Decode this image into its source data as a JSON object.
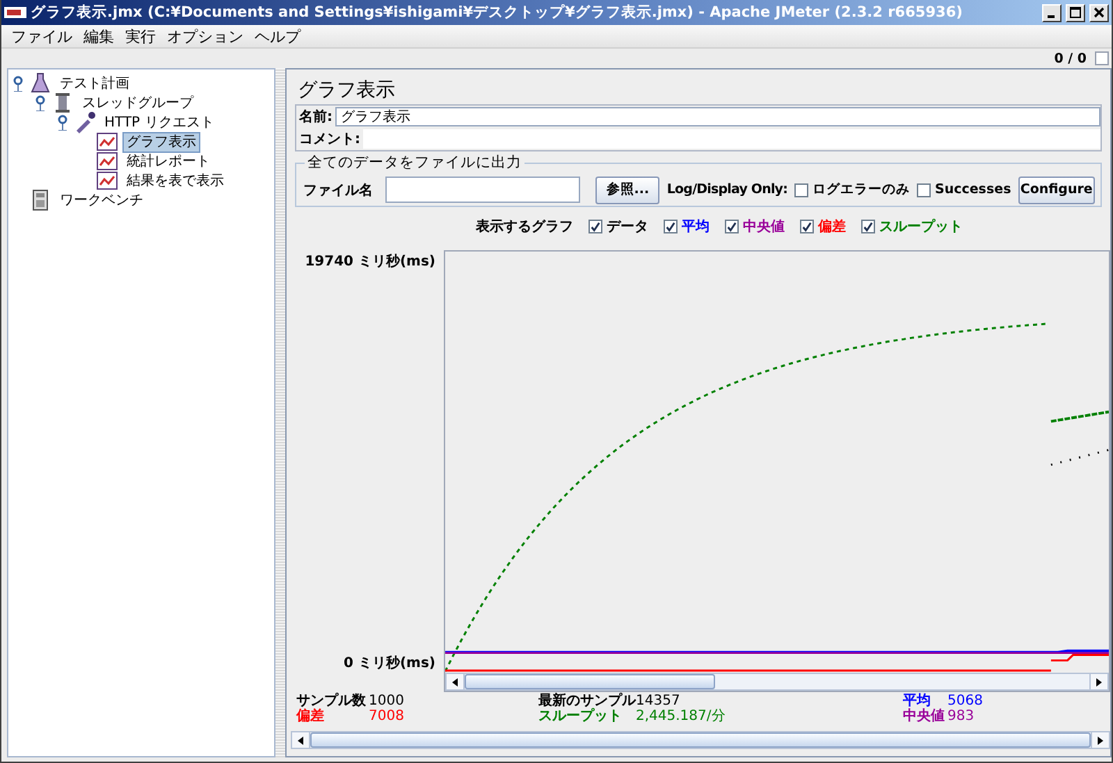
{
  "window": {
    "title": "グラフ表示.jmx (C:¥Documents and Settings¥ishigami¥デスクトップ¥グラフ表示.jmx) - Apache JMeter (2.3.2 r665936)"
  },
  "menu": [
    "ファイル",
    "編集",
    "実行",
    "オプション",
    "ヘルプ"
  ],
  "toolbar": {
    "counter": "0 / 0"
  },
  "tree": [
    {
      "label": "テスト計画",
      "kind": "plan",
      "selected": false,
      "children": [
        {
          "label": "スレッドグループ",
          "kind": "thread-group",
          "selected": false,
          "children": [
            {
              "label": "HTTP リクエスト",
              "kind": "sampler",
              "selected": false,
              "children": [
                {
                  "label": "グラフ表示",
                  "kind": "listener",
                  "selected": true
                },
                {
                  "label": "統計レポート",
                  "kind": "listener",
                  "selected": false
                },
                {
                  "label": "結果を表で表示",
                  "kind": "listener",
                  "selected": false
                }
              ]
            }
          ]
        }
      ]
    },
    {
      "label": "ワークベンチ",
      "kind": "workbench",
      "selected": false
    }
  ],
  "panel": {
    "title": "グラフ表示",
    "name_label": "名前:",
    "name_value": "グラフ表示",
    "comment_label": "コメント:",
    "file_group": {
      "legend": "全てのデータをファイルに出力",
      "file_label": "ファイル名",
      "browse_button": "参照...",
      "log_label": "Log/Display Only:",
      "options": [
        {
          "label": "ログエラーのみ",
          "checked": false
        },
        {
          "label": "Successes",
          "checked": false
        }
      ],
      "configure_button": "Configure"
    },
    "graphs_label": "表示するグラフ",
    "graphs": [
      {
        "label": "データ",
        "checked": true,
        "color": "#000000"
      },
      {
        "label": "平均",
        "checked": true,
        "color": "#0000ff"
      },
      {
        "label": "中央値",
        "checked": true,
        "color": "#990099"
      },
      {
        "label": "偏差",
        "checked": true,
        "color": "#ff0000"
      },
      {
        "label": "スループット",
        "checked": true,
        "color": "#008000"
      }
    ],
    "y_max_label": "19740  ミリ秒(ms)",
    "y_min_label": "0  ミリ秒(ms)",
    "stats": [
      {
        "label": "サンプル数",
        "value": "1000",
        "color": "#000000"
      },
      {
        "label": "最新のサンプル",
        "value": "14357",
        "color": "#000000"
      },
      {
        "label": "平均",
        "value": "5068",
        "color": "#0000ff"
      },
      {
        "label": "偏差",
        "value": "7008",
        "color": "#ff0000"
      },
      {
        "label": "スループット",
        "value": "2,445.187/分",
        "color": "#008000"
      },
      {
        "label": "中央値",
        "value": "983",
        "color": "#990099"
      }
    ]
  }
}
